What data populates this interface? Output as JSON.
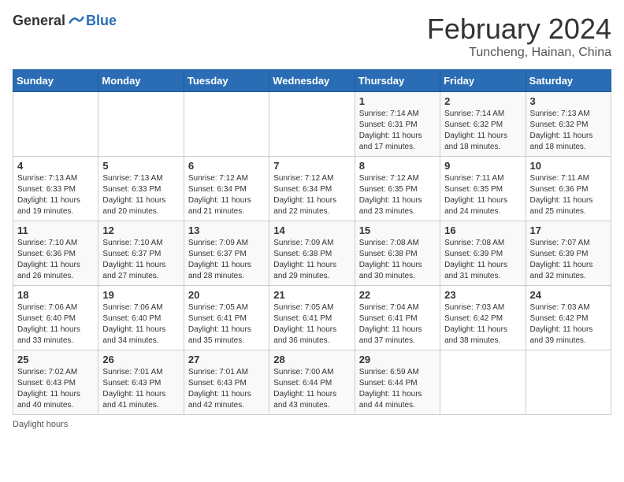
{
  "header": {
    "logo_general": "General",
    "logo_blue": "Blue",
    "month_title": "February 2024",
    "location": "Tuncheng, Hainan, China"
  },
  "days_of_week": [
    "Sunday",
    "Monday",
    "Tuesday",
    "Wednesday",
    "Thursday",
    "Friday",
    "Saturday"
  ],
  "footer": {
    "daylight_label": "Daylight hours"
  },
  "weeks": [
    {
      "cells": [
        {
          "day": "",
          "info": ""
        },
        {
          "day": "",
          "info": ""
        },
        {
          "day": "",
          "info": ""
        },
        {
          "day": "",
          "info": ""
        },
        {
          "day": "1",
          "info": "Sunrise: 7:14 AM\nSunset: 6:31 PM\nDaylight: 11 hours and 17 minutes."
        },
        {
          "day": "2",
          "info": "Sunrise: 7:14 AM\nSunset: 6:32 PM\nDaylight: 11 hours and 18 minutes."
        },
        {
          "day": "3",
          "info": "Sunrise: 7:13 AM\nSunset: 6:32 PM\nDaylight: 11 hours and 18 minutes."
        }
      ]
    },
    {
      "cells": [
        {
          "day": "4",
          "info": "Sunrise: 7:13 AM\nSunset: 6:33 PM\nDaylight: 11 hours and 19 minutes."
        },
        {
          "day": "5",
          "info": "Sunrise: 7:13 AM\nSunset: 6:33 PM\nDaylight: 11 hours and 20 minutes."
        },
        {
          "day": "6",
          "info": "Sunrise: 7:12 AM\nSunset: 6:34 PM\nDaylight: 11 hours and 21 minutes."
        },
        {
          "day": "7",
          "info": "Sunrise: 7:12 AM\nSunset: 6:34 PM\nDaylight: 11 hours and 22 minutes."
        },
        {
          "day": "8",
          "info": "Sunrise: 7:12 AM\nSunset: 6:35 PM\nDaylight: 11 hours and 23 minutes."
        },
        {
          "day": "9",
          "info": "Sunrise: 7:11 AM\nSunset: 6:35 PM\nDaylight: 11 hours and 24 minutes."
        },
        {
          "day": "10",
          "info": "Sunrise: 7:11 AM\nSunset: 6:36 PM\nDaylight: 11 hours and 25 minutes."
        }
      ]
    },
    {
      "cells": [
        {
          "day": "11",
          "info": "Sunrise: 7:10 AM\nSunset: 6:36 PM\nDaylight: 11 hours and 26 minutes."
        },
        {
          "day": "12",
          "info": "Sunrise: 7:10 AM\nSunset: 6:37 PM\nDaylight: 11 hours and 27 minutes."
        },
        {
          "day": "13",
          "info": "Sunrise: 7:09 AM\nSunset: 6:37 PM\nDaylight: 11 hours and 28 minutes."
        },
        {
          "day": "14",
          "info": "Sunrise: 7:09 AM\nSunset: 6:38 PM\nDaylight: 11 hours and 29 minutes."
        },
        {
          "day": "15",
          "info": "Sunrise: 7:08 AM\nSunset: 6:38 PM\nDaylight: 11 hours and 30 minutes."
        },
        {
          "day": "16",
          "info": "Sunrise: 7:08 AM\nSunset: 6:39 PM\nDaylight: 11 hours and 31 minutes."
        },
        {
          "day": "17",
          "info": "Sunrise: 7:07 AM\nSunset: 6:39 PM\nDaylight: 11 hours and 32 minutes."
        }
      ]
    },
    {
      "cells": [
        {
          "day": "18",
          "info": "Sunrise: 7:06 AM\nSunset: 6:40 PM\nDaylight: 11 hours and 33 minutes."
        },
        {
          "day": "19",
          "info": "Sunrise: 7:06 AM\nSunset: 6:40 PM\nDaylight: 11 hours and 34 minutes."
        },
        {
          "day": "20",
          "info": "Sunrise: 7:05 AM\nSunset: 6:41 PM\nDaylight: 11 hours and 35 minutes."
        },
        {
          "day": "21",
          "info": "Sunrise: 7:05 AM\nSunset: 6:41 PM\nDaylight: 11 hours and 36 minutes."
        },
        {
          "day": "22",
          "info": "Sunrise: 7:04 AM\nSunset: 6:41 PM\nDaylight: 11 hours and 37 minutes."
        },
        {
          "day": "23",
          "info": "Sunrise: 7:03 AM\nSunset: 6:42 PM\nDaylight: 11 hours and 38 minutes."
        },
        {
          "day": "24",
          "info": "Sunrise: 7:03 AM\nSunset: 6:42 PM\nDaylight: 11 hours and 39 minutes."
        }
      ]
    },
    {
      "cells": [
        {
          "day": "25",
          "info": "Sunrise: 7:02 AM\nSunset: 6:43 PM\nDaylight: 11 hours and 40 minutes."
        },
        {
          "day": "26",
          "info": "Sunrise: 7:01 AM\nSunset: 6:43 PM\nDaylight: 11 hours and 41 minutes."
        },
        {
          "day": "27",
          "info": "Sunrise: 7:01 AM\nSunset: 6:43 PM\nDaylight: 11 hours and 42 minutes."
        },
        {
          "day": "28",
          "info": "Sunrise: 7:00 AM\nSunset: 6:44 PM\nDaylight: 11 hours and 43 minutes."
        },
        {
          "day": "29",
          "info": "Sunrise: 6:59 AM\nSunset: 6:44 PM\nDaylight: 11 hours and 44 minutes."
        },
        {
          "day": "",
          "info": ""
        },
        {
          "day": "",
          "info": ""
        }
      ]
    }
  ]
}
